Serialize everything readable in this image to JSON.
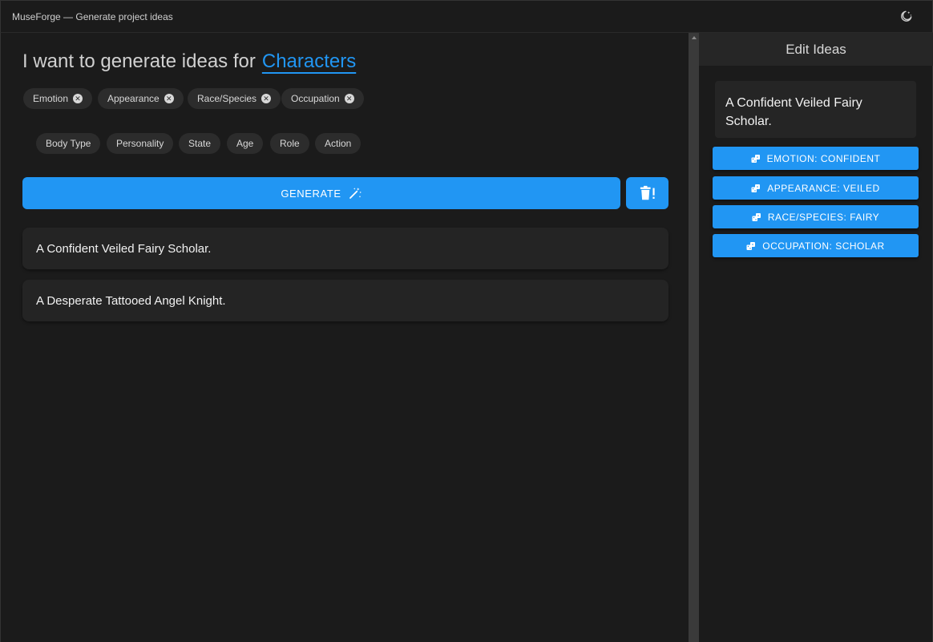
{
  "window": {
    "title": "MuseForge — Generate project ideas",
    "theme_icon": "moon-icon"
  },
  "main": {
    "heading_prefix": "I want to generate ideas for",
    "heading_target": "Characters",
    "selected_categories": [
      "Emotion",
      "Appearance",
      "Race/Species",
      "Occupation"
    ],
    "available_categories": [
      "Body Type",
      "Personality",
      "State",
      "Age",
      "Role",
      "Action"
    ],
    "generate_label": "GENERATE",
    "generate_icon": "magic-wand-icon",
    "delete_icon": "trash-alert-icon",
    "ideas": [
      "A Confident Veiled Fairy Scholar.",
      "A Desperate Tattooed Angel Knight."
    ]
  },
  "sidebar": {
    "title": "Edit Ideas",
    "selected_idea": "A Confident Veiled Fairy Scholar.",
    "reroll_icon": "dice-icon",
    "attributes": [
      "EMOTION: CONFIDENT",
      "APPEARANCE: VEILED",
      "RACE/SPECIES: FAIRY",
      "OCCUPATION: SCHOLAR"
    ]
  },
  "colors": {
    "accent": "#2196f3",
    "background": "#1b1b1b",
    "chip": "#2c2c2c",
    "card": "#242424"
  }
}
